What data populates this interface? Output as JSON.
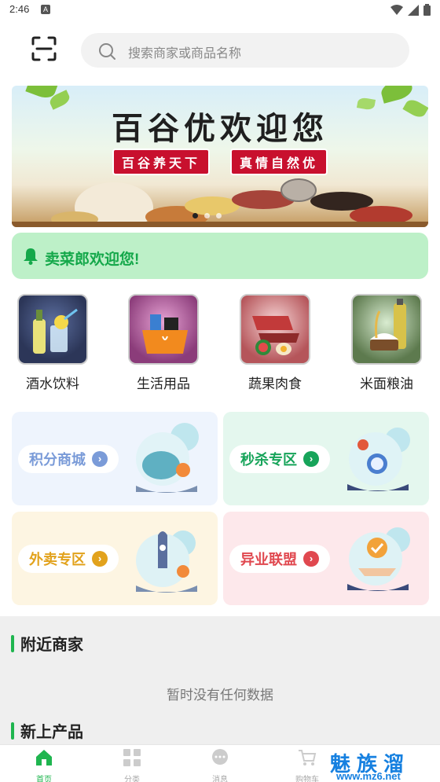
{
  "status_bar": {
    "time": "2:46",
    "notification_badge": "A"
  },
  "header": {
    "search_placeholder": "搜索商家或商品名称"
  },
  "banner": {
    "title": "百谷优欢迎您",
    "tags": [
      "百谷养天下",
      "真情自然优"
    ],
    "dot_count": 3,
    "active_dot": 0
  },
  "notice": {
    "text": "卖菜郎欢迎您!"
  },
  "categories": [
    {
      "label": "酒水饮料",
      "icon": "drinks-icon"
    },
    {
      "label": "生活用品",
      "icon": "household-icon"
    },
    {
      "label": "蔬果肉食",
      "icon": "meat-icon"
    },
    {
      "label": "米面粮油",
      "icon": "grain-oil-icon"
    }
  ],
  "promos": [
    {
      "label": "积分商城",
      "color": "#7a9bd8",
      "bg": "#eef4fd"
    },
    {
      "label": "秒杀专区",
      "color": "#17a45a",
      "bg": "#e4f7ee"
    },
    {
      "label": "外卖专区",
      "color": "#e2a21c",
      "bg": "#fdf5e2"
    },
    {
      "label": "异业联盟",
      "color": "#e0484f",
      "bg": "#fde8eb"
    }
  ],
  "sections": {
    "nearby_title": "附近商家",
    "empty_text": "暂时没有任何数据",
    "new_title": "新上产品"
  },
  "tabbar": {
    "items": [
      {
        "label": "首页",
        "active": true
      },
      {
        "label": "分类",
        "active": false
      },
      {
        "label": "消息",
        "active": false
      },
      {
        "label": "购物车",
        "active": false
      }
    ]
  },
  "watermark": {
    "big": "魅族溜",
    "small": "www.mz6.net"
  },
  "colors": {
    "accent": "#1fb54f",
    "notice_bg": "#bdf0c8",
    "banner_tag": "#c8102e"
  }
}
